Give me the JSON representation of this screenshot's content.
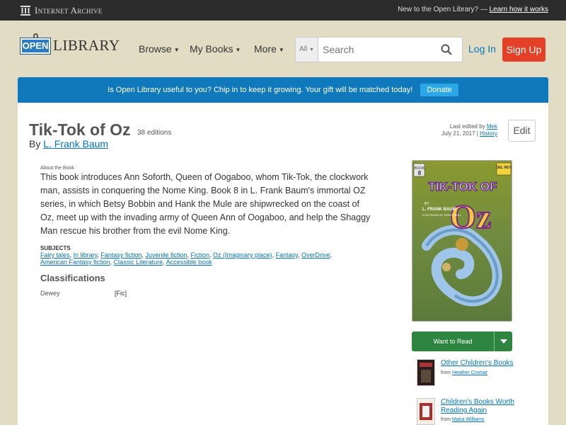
{
  "ia_bar": {
    "logo_text": "Internet Archive",
    "prompt": "New to the Open Library? —",
    "link": "Learn how it works"
  },
  "header": {
    "logo_open": "OPEN",
    "logo_library": "LIBRARY",
    "nav": [
      {
        "label": "Browse"
      },
      {
        "label": "My Books"
      },
      {
        "label": "More"
      }
    ],
    "search": {
      "scope": "All",
      "placeholder": "Search"
    },
    "login": "Log In",
    "signup": "Sign Up"
  },
  "donate": {
    "text": "Is Open Library useful to you? Chip in to keep it growing. Your gift will be matched today!",
    "button": "Donate"
  },
  "book": {
    "title": "Tik-Tok of Oz",
    "editions": "38 editions",
    "by": "By",
    "author": "L. Frank Baum",
    "edited_prefix": "Last edited by",
    "edited_by": "Mek",
    "edited_date": "July 21, 2017 |",
    "history": "History",
    "edit_button": "Edit",
    "about_label": "About the Book",
    "description": "This book introduces Ann Soforth, Queen of Oogaboo, whom Tik-Tok, the clockwork man, assists in conquering the Nome King. Book 8 in L. Frank Baum's immortal OZ series, in which Betsy Bobbin and Hank the Mule are shipwrecked on the coast of Oz, meet up with the invading army of Queen Ann of Oogaboo, and help the Shaggy Man rescue his brother from the evil Nome King.",
    "subjects_label": "SUBJECTS",
    "subjects": [
      "Fairy tales",
      "In library",
      "Fantasy fiction",
      "Juvenile fiction",
      "Fiction",
      "Oz (Imaginary place)",
      "Fantasy",
      "OverDrive",
      "American Fantasy fiction",
      "Classic Literature",
      "Accessible book"
    ],
    "classifications_heading": "Classifications",
    "dewey_label": "Dewey",
    "dewey_value": "[Fic]"
  },
  "cover": {
    "book_label": "BOOK",
    "book_number": "8",
    "publisher": "DEL REY",
    "title_line1": "TIK-TOK OF",
    "title_line2": "Oz",
    "by": "BY",
    "author": "L. FRANK BAUM",
    "illustrated": "ILLUSTRATED BY JOHN R. NEILL"
  },
  "want_to_read": "Want to Read",
  "lists": [
    {
      "title": "Other Children's Books",
      "from_label": "from",
      "from": "Heather Cromar"
    },
    {
      "title": "Children's Books Worth Reading Again",
      "from_label": "from",
      "from": "Maria Williams"
    }
  ]
}
